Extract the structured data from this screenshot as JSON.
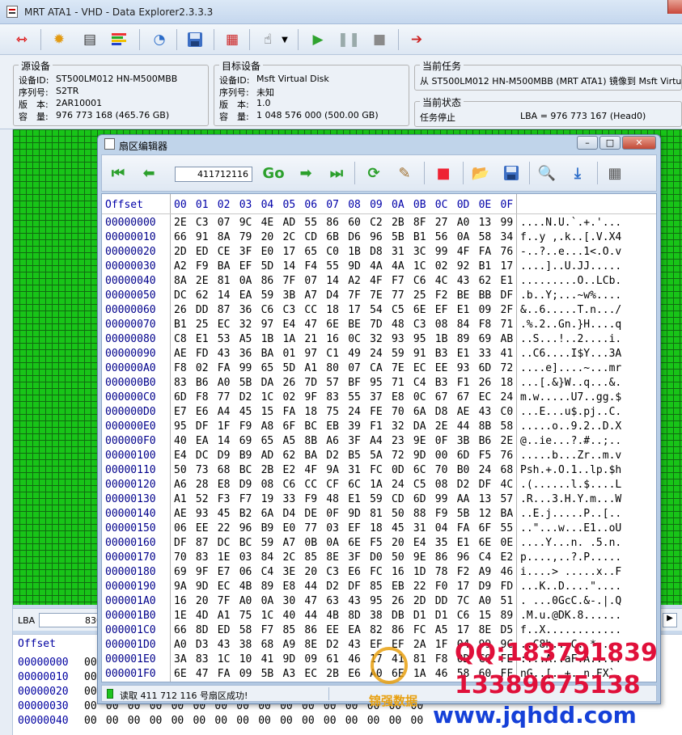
{
  "window": {
    "title": "MRT ATA1 - VHD - Data Explorer2.3.3.3"
  },
  "toolbar": {
    "icons": [
      "connect-icon",
      "settings-gear-icon",
      "device-info-icon",
      "color-bars-icon",
      "timer-icon",
      "save-icon",
      "sector-editor-icon",
      "pointer-icon",
      "dropdown-arrow-icon",
      "play-icon",
      "pause-icon",
      "stop-icon",
      "exit-icon"
    ]
  },
  "source": {
    "title": "源设备",
    "id_label": "设备ID:",
    "id_value": "ST500LM012 HN-M500MBB",
    "serial_label": "序列号:",
    "serial_value": "S2TR",
    "version_label": "版　本:",
    "version_value": "2AR10001",
    "cap_label": "容　量:",
    "cap_value": "976 773 168 (465.76 GB)"
  },
  "target": {
    "title": "目标设备",
    "id_label": "设备ID:",
    "id_value": "Msft Virtual Disk",
    "serial_label": "序列号:",
    "serial_value": "未知",
    "version_label": "版　本:",
    "version_value": "1.0",
    "cap_label": "容　量:",
    "cap_value": "1 048 576 000 (500.00 GB)"
  },
  "task": {
    "title": "当前任务",
    "text": "从 ST500LM012 HN-M500MBB (MRT ATA1) 镜像到 Msft Virtual Disk"
  },
  "status": {
    "title": "当前状态",
    "state": "任务停止",
    "lba_text": "LBA = 976 773 167 (Head0)"
  },
  "lba_bar": {
    "label": "LBA",
    "value": "8301"
  },
  "lower": {
    "offset_header": "Offset",
    "offsets": [
      "00000000",
      "00000010",
      "00000020",
      "00000030",
      "00000040"
    ],
    "byte": "00"
  },
  "editor": {
    "title": "扇区编辑器",
    "sector_input": "411712116",
    "go_label": "Go",
    "offset_header": "Offset",
    "col_headers": [
      "00",
      "01",
      "02",
      "03",
      "04",
      "05",
      "06",
      "07",
      "08",
      "09",
      "0A",
      "0B",
      "0C",
      "0D",
      "0E",
      "0F"
    ],
    "rows": [
      {
        "off": "00000000",
        "hex": "2E C3 07 9C 4E AD 55 86 60 C2 2B 8F 27 A0 13 99",
        "ascii": "....N.U.`.+.'..."
      },
      {
        "off": "00000010",
        "hex": "66 91 8A 79 20 2C CD 6B D6 96 5B B1 56 0A 58 34",
        "ascii": "f..y ,.k..[.V.X4"
      },
      {
        "off": "00000020",
        "hex": "2D ED CE 3F E0 17 65 C0 1B D8 31 3C 99 4F FA 76",
        "ascii": "-..?..e...1<.O.v"
      },
      {
        "off": "00000030",
        "hex": "A2 F9 BA EF 5D 14 F4 55 9D 4A 4A 1C 02 92 B1 17",
        "ascii": "....]..U.JJ....."
      },
      {
        "off": "00000040",
        "hex": "8A 2E 81 0A 86 7F 07 14 A2 4F F7 C6 4C 43 62 E1",
        "ascii": ".........O..LCb."
      },
      {
        "off": "00000050",
        "hex": "DC 62 14 EA 59 3B A7 D4 7F 7E 77 25 F2 BE BB DF",
        "ascii": ".b..Y;...~w%...."
      },
      {
        "off": "00000060",
        "hex": "26 DD 87 36 C6 C3 CC 18 17 54 C5 6E EF E1 09 2F",
        "ascii": "&..6.....T.n.../"
      },
      {
        "off": "00000070",
        "hex": "B1 25 EC 32 97 E4 47 6E BE 7D 48 C3 08 84 F8 71",
        "ascii": ".%.2..Gn.}H....q"
      },
      {
        "off": "00000080",
        "hex": "C8 E1 53 A5 1B 1A 21 16 0C 32 93 95 1B 89 69 AB",
        "ascii": "..S...!..2....i."
      },
      {
        "off": "00000090",
        "hex": "AE FD 43 36 BA 01 97 C1 49 24 59 91 B3 E1 33 41",
        "ascii": "..C6....I$Y...3A"
      },
      {
        "off": "000000A0",
        "hex": "F8 02 FA 99 65 5D A1 80 07 CA 7E EC EE 93 6D 72",
        "ascii": "....e]....~...mr"
      },
      {
        "off": "000000B0",
        "hex": "83 B6 A0 5B DA 26 7D 57 BF 95 71 C4 B3 F1 26 18",
        "ascii": "...[.&}W..q...&."
      },
      {
        "off": "000000C0",
        "hex": "6D F8 77 D2 1C 02 9F 83 55 37 E8 0C 67 67 EC 24",
        "ascii": "m.w.....U7..gg.$"
      },
      {
        "off": "000000D0",
        "hex": "E7 E6 A4 45 15 FA 18 75 24 FE 70 6A D8 AE 43 C0",
        "ascii": "...E...u$.pj..C."
      },
      {
        "off": "000000E0",
        "hex": "95 DF 1F F9 A8 6F BC EB 39 F1 32 DA 2E 44 8B 58",
        "ascii": ".....o..9.2..D.X"
      },
      {
        "off": "000000F0",
        "hex": "40 EA 14 69 65 A5 8B A6 3F A4 23 9E 0F 3B B6 2E",
        "ascii": "@..ie...?.#..;.."
      },
      {
        "off": "00000100",
        "hex": "E4 DC D9 B9 AD 62 BA D2 B5 5A 72 9D 00 6D F5 76",
        "ascii": ".....b...Zr..m.v"
      },
      {
        "off": "00000110",
        "hex": "50 73 68 BC 2B E2 4F 9A 31 FC 0D 6C 70 B0 24 68",
        "ascii": "Psh.+.O.1..lp.$h"
      },
      {
        "off": "00000120",
        "hex": "A6 28 E8 D9 08 C6 CC CF 6C 1A 24 C5 08 D2 DF 4C",
        "ascii": ".(......l.$....L"
      },
      {
        "off": "00000130",
        "hex": "A1 52 F3 F7 19 33 F9 48 E1 59 CD 6D 99 AA 13 57",
        "ascii": ".R...3.H.Y.m...W"
      },
      {
        "off": "00000140",
        "hex": "AE 93 45 B2 6A D4 DE 0F 9D 81 50 88 F9 5B 12 BA",
        "ascii": "..E.j.....P..[.."
      },
      {
        "off": "00000150",
        "hex": "06 EE 22 96 B9 E0 77 03 EF 18 45 31 04 FA 6F 55",
        "ascii": "..\"...w...E1..oU"
      },
      {
        "off": "00000160",
        "hex": "DF 87 DC BC 59 A7 0B 0A 6E F5 20 E4 35 E1 6E 0E",
        "ascii": "....Y...n. .5.n."
      },
      {
        "off": "00000170",
        "hex": "70 83 1E 03 84 2C 85 8E 3F D0 50 9E 86 96 C4 E2",
        "ascii": "p....,..?.P....."
      },
      {
        "off": "00000180",
        "hex": "69 9F E7 06 C4 3E 20 C3 E6 FC 16 1D 78 F2 A9 46",
        "ascii": "i....> .....x..F"
      },
      {
        "off": "00000190",
        "hex": "9A 9D EC 4B 89 E8 44 D2 DF 85 EB 22 F0 17 D9 FD",
        "ascii": "...K..D....\"...."
      },
      {
        "off": "000001A0",
        "hex": "16 20 7F A0 0A 30 47 63 43 95 26 2D DD 7C A0 51",
        "ascii": ". ...0GcC.&-.|.Q"
      },
      {
        "off": "000001B0",
        "hex": "1E 4D A1 75 1C 40 44 4B 8D 38 DB D1 D1 C6 15 89",
        "ascii": ".M.u.@DK.8......"
      },
      {
        "off": "000001C0",
        "hex": "66 8D ED 58 F7 85 86 EE EA 82 86 FC A5 17 8E D5",
        "ascii": "f..X............"
      },
      {
        "off": "000001D0",
        "hex": "A0 D3 43 38 68 A9 8E D2 43 EF EF 2A 1F 04 99 9C",
        "ascii": "..C8h...C..*...."
      },
      {
        "off": "000001E0",
        "hex": "3A 83 1C 10 41 9D 09 61 46 17 41 81 F8 0D C9 FE",
        "ascii": ":...A..aF.A....."
      },
      {
        "off": "000001F0",
        "hex": "6E 47 FA 09 5B A3 EC 2B E6 A0 6E 1A 46 58 60 FF",
        "ascii": "nG..[..+..n.FX`."
      }
    ],
    "status_text": "读取 411 712 116 号扇区成功!"
  },
  "watermark": {
    "qq": "QQ:183791839",
    "phone": "13389675138",
    "url": "www.jqhdd.com",
    "brand": "锦强数据"
  },
  "colors": {
    "accent": "#1fc41f",
    "offset_blue": "#00008b",
    "watermark_red": "#e0103a",
    "watermark_blue": "#1540d8"
  }
}
